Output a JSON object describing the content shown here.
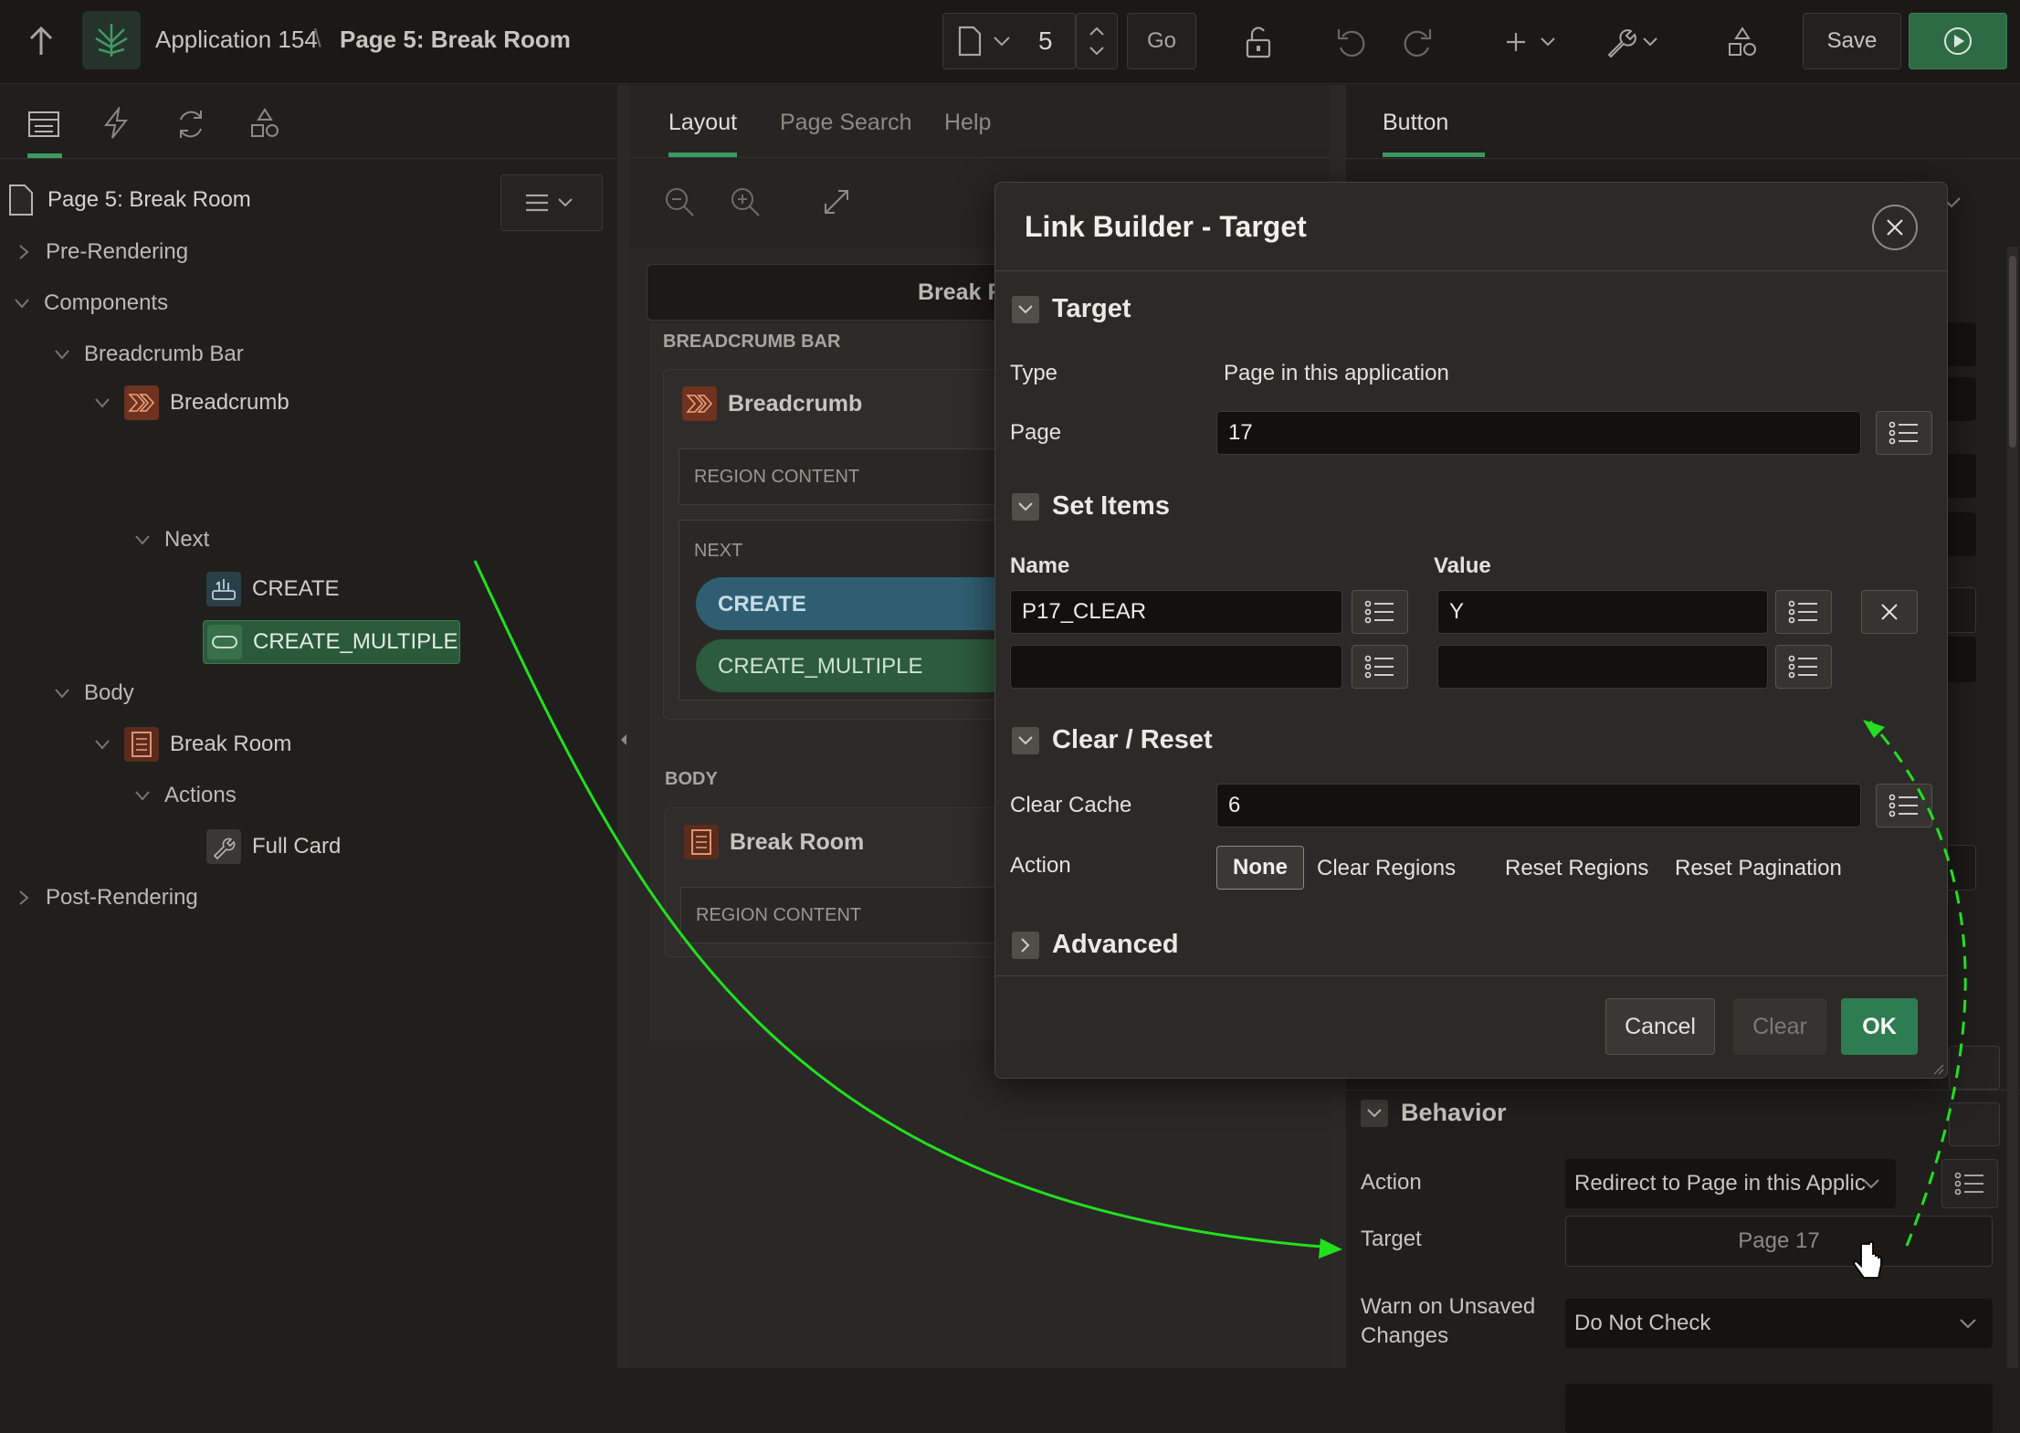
{
  "topbar": {
    "app_name": "Application 154",
    "separator": "\\",
    "page_title": "Page 5: Break Room",
    "page_number": "5",
    "go_label": "Go",
    "save_label": "Save"
  },
  "left_panel": {
    "page_node": "Page 5: Break Room",
    "tree": [
      {
        "label": "Pre-Rendering"
      },
      {
        "label": "Components"
      },
      {
        "label": "Breadcrumb Bar"
      },
      {
        "label": "Breadcrumb"
      },
      {
        "label": "Next"
      },
      {
        "label": "CREATE"
      },
      {
        "label": "CREATE_MULTIPLE"
      },
      {
        "label": "Body"
      },
      {
        "label": "Break Room"
      },
      {
        "label": "Actions"
      },
      {
        "label": "Full Card"
      },
      {
        "label": "Post-Rendering"
      }
    ]
  },
  "middle_panel": {
    "tabs": [
      "Layout",
      "Page Search",
      "Help"
    ],
    "header_text": "Break R",
    "breadcrumb_bar_label": "BREADCRUMB BAR",
    "breadcrumb_region": "Breadcrumb",
    "region_content": "REGION CONTENT",
    "next_label": "NEXT",
    "create_btn": "CREATE",
    "create_multiple_btn": "CREATE_MULTIPLE",
    "body_label": "BODY",
    "break_room_region": "Break Room",
    "region_content_2": "REGION CONTENT"
  },
  "right_panel": {
    "tab": "Button",
    "behavior_title": "Behavior",
    "action_label": "Action",
    "action_value": "Redirect to Page in this Applic",
    "target_label": "Target",
    "target_value": "Page 17",
    "warn_label_1": "Warn on Unsaved",
    "warn_label_2": "Changes",
    "warn_value": "Do Not Check"
  },
  "dialog": {
    "title": "Link Builder - Target",
    "target_section": "Target",
    "type_label": "Type",
    "type_value": "Page in this application",
    "page_label": "Page",
    "page_value": "17",
    "set_items_section": "Set Items",
    "name_header": "Name",
    "value_header": "Value",
    "items": [
      {
        "name": "P17_CLEAR",
        "value": "Y"
      },
      {
        "name": "",
        "value": ""
      }
    ],
    "clear_reset_section": "Clear / Reset",
    "clear_cache_label": "Clear Cache",
    "clear_cache_value": "6",
    "action_label": "Action",
    "action_options": [
      "None",
      "Clear Regions",
      "Reset Regions",
      "Reset Pagination"
    ],
    "action_selected": "None",
    "advanced_section": "Advanced",
    "cancel_label": "Cancel",
    "clear_label": "Clear",
    "ok_label": "OK"
  },
  "colors": {
    "accent_green": "#2e7d52",
    "annotation_arrow": "#22e01d",
    "create_blue": "#2f5e72",
    "create_multiple_green": "#2c5b3d",
    "breadcrumb_icon": "#7a3b24"
  }
}
